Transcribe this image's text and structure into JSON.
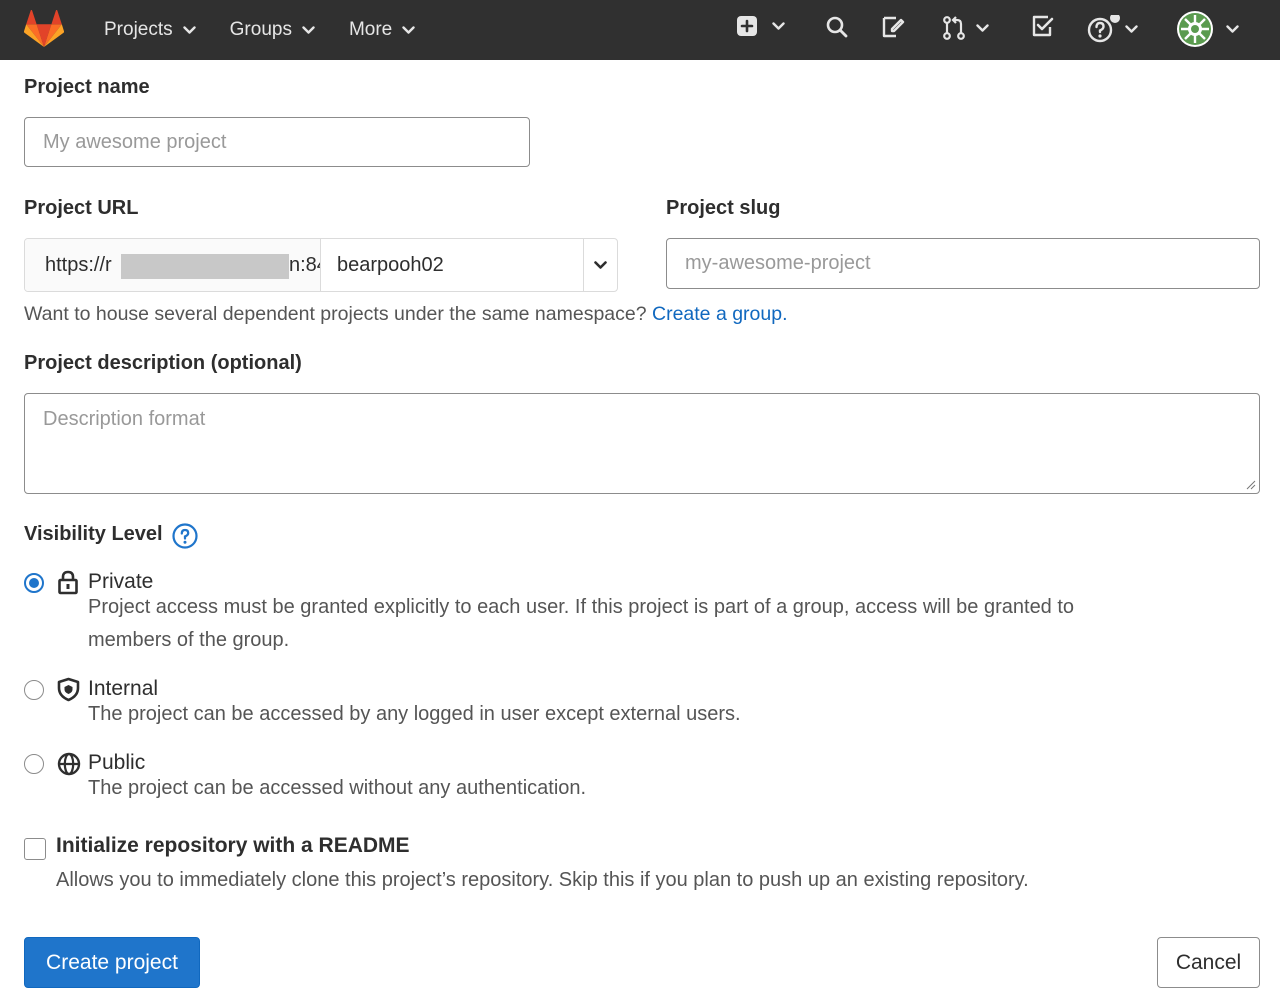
{
  "navbar": {
    "logo": "gitlab-tanuki-logo",
    "menu": [
      {
        "label": "Projects",
        "icon": "chevron-down-icon"
      },
      {
        "label": "Groups",
        "icon": "chevron-down-icon"
      },
      {
        "label": "More",
        "icon": "chevron-down-icon"
      }
    ],
    "icons": [
      "plus-square-icon",
      "search-icon",
      "issues-icon",
      "merge-request-icon",
      "todo-icon",
      "help-icon",
      "user-avatar"
    ]
  },
  "form": {
    "project_name": {
      "label": "Project name",
      "placeholder": "My awesome project"
    },
    "project_url": {
      "label": "Project URL",
      "prefix": "https://r",
      "prefix_tail": "n:84",
      "namespace": "bearpooh02"
    },
    "project_slug": {
      "label": "Project slug",
      "placeholder": "my-awesome-project"
    },
    "namespace_help": {
      "text": "Want to house several dependent projects under the same namespace? ",
      "link": "Create a group."
    },
    "description": {
      "label": "Project description (optional)",
      "placeholder": "Description format"
    },
    "visibility": {
      "label": "Visibility Level",
      "options": [
        {
          "title": "Private",
          "icon": "lock-icon",
          "checked": true,
          "desc_line1": "Project access must be granted explicitly to each user. If this project is part of a group, access will be granted to",
          "desc_line2": "members of the group."
        },
        {
          "title": "Internal",
          "icon": "shield-icon",
          "checked": false,
          "desc_line1": "The project can be accessed by any logged in user except external users."
        },
        {
          "title": "Public",
          "icon": "globe-icon",
          "checked": false,
          "desc_line1": "The project can be accessed without any authentication."
        }
      ]
    },
    "readme": {
      "label": "Initialize repository with a README",
      "checked": false,
      "desc": "Allows you to immediately clone this project’s repository. Skip this if you plan to push up an existing repository."
    },
    "buttons": {
      "create": "Create project",
      "cancel": "Cancel"
    }
  },
  "colors": {
    "navbar": "#303030",
    "primary": "#1f75cb",
    "link": "#1068bf"
  }
}
